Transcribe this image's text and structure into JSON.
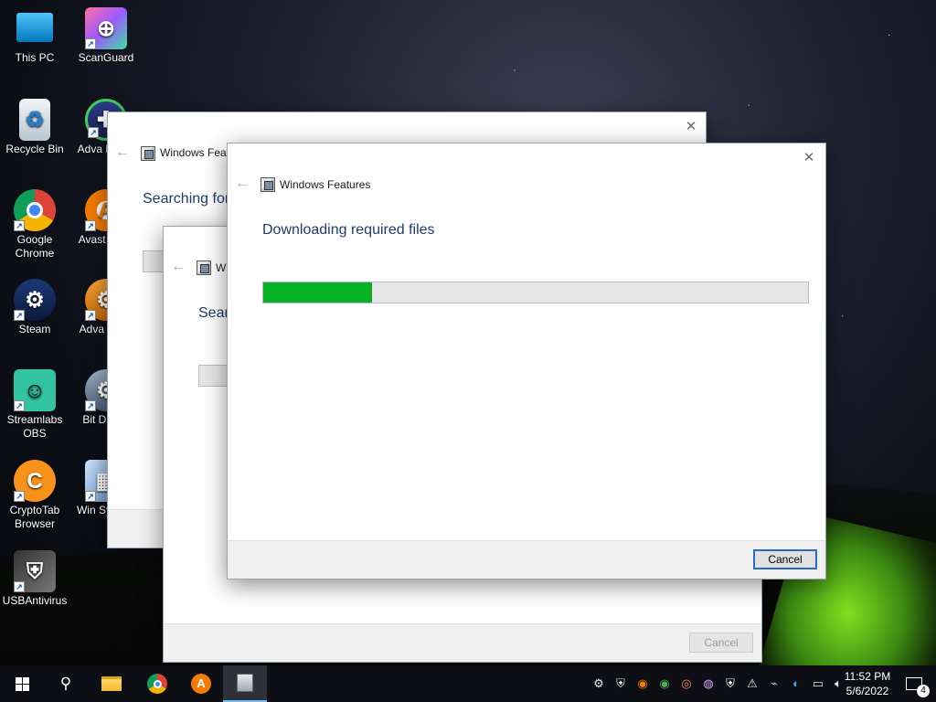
{
  "desktop": {
    "icons": [
      {
        "label": "This PC"
      },
      {
        "label": "ScanGuard"
      },
      {
        "label": "Recycle Bin"
      },
      {
        "label": "Adva Driver"
      },
      {
        "label": "Google Chrome"
      },
      {
        "label": "Avast Brow"
      },
      {
        "label": "Steam"
      },
      {
        "label": "Adva Drive"
      },
      {
        "label": "Streamlabs OBS"
      },
      {
        "label": "Bit D Upd"
      },
      {
        "label": "CryptoTab Browser"
      },
      {
        "label": "Win System"
      },
      {
        "label": "USBAntivirus"
      }
    ]
  },
  "dialogs": {
    "back1": {
      "title": "Windows Feat",
      "heading": "Searching for"
    },
    "back2": {
      "title": "W",
      "heading": "Sear",
      "cancel_label": "Cancel"
    },
    "front": {
      "title": "Windows Features",
      "heading": "Downloading required files",
      "progress_fraction": 0.2,
      "progress_color": "#06b025",
      "cancel_label": "Cancel",
      "close_glyph": "✕",
      "back_glyph": "←"
    }
  },
  "taskbar": {
    "apps": [
      "start-icon",
      "search-icon",
      "file-explorer-icon",
      "chrome-icon",
      "avast-browser-icon",
      "windows-features-icon"
    ],
    "clock_time": "11:52 PM",
    "clock_date": "5/6/2022",
    "notification_count": "4"
  },
  "colors": {
    "accent": "#2a6bc5",
    "heading": "#1f3b6e"
  }
}
